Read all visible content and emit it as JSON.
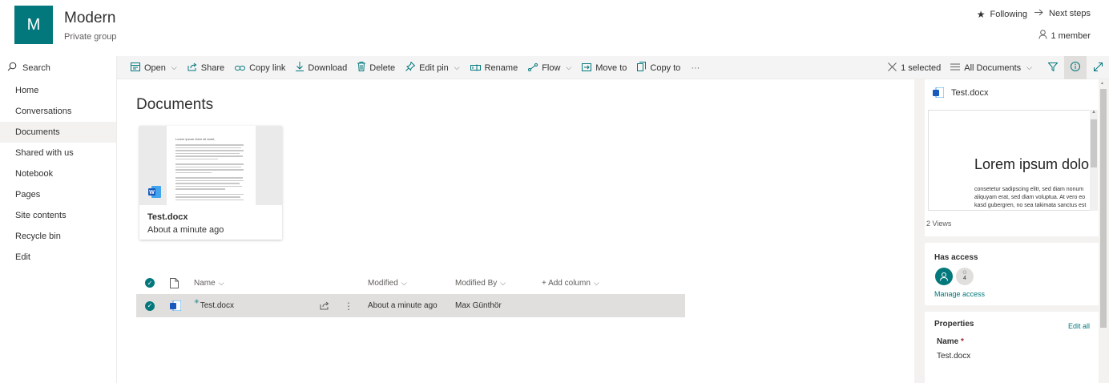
{
  "colors": {
    "accent": "#03787c",
    "nav_selected": "#f3f2f1",
    "row_selected": "#e1dfdd",
    "panel_bg": "#f3f2f1"
  },
  "site": {
    "logo_letter": "M",
    "title": "Modern",
    "subtitle": "Private group"
  },
  "header_actions": {
    "following": "Following",
    "next_steps": "Next steps",
    "members": "1 member"
  },
  "search": {
    "label": "Search"
  },
  "commands": [
    {
      "label": "Open",
      "icon": "open-icon",
      "chevron": true
    },
    {
      "label": "Share",
      "icon": "share-icon",
      "chevron": false
    },
    {
      "label": "Copy link",
      "icon": "link-icon",
      "chevron": false
    },
    {
      "label": "Download",
      "icon": "download-icon",
      "chevron": false
    },
    {
      "label": "Delete",
      "icon": "delete-icon",
      "chevron": false
    },
    {
      "label": "Edit pin",
      "icon": "pin-icon",
      "chevron": true
    },
    {
      "label": "Rename",
      "icon": "rename-icon",
      "chevron": false
    },
    {
      "label": "Flow",
      "icon": "flow-icon",
      "chevron": true
    },
    {
      "label": "Move to",
      "icon": "move-icon",
      "chevron": false
    },
    {
      "label": "Copy to",
      "icon": "copy-icon",
      "chevron": false
    }
  ],
  "more_label": "···",
  "right_commands": {
    "selected": "1 selected",
    "view": "All Documents"
  },
  "nav": {
    "items": [
      "Home",
      "Conversations",
      "Documents",
      "Shared with us",
      "Notebook",
      "Pages",
      "Site contents",
      "Recycle bin",
      "Edit"
    ],
    "selected_index": 2
  },
  "main": {
    "title": "Documents",
    "tile": {
      "name": "Test.docx",
      "meta": "About a minute ago",
      "preview_heading": "Lorem ipsum dolor sit amet,",
      "file_badge": "W"
    },
    "columns": {
      "name": "Name",
      "modified": "Modified",
      "modified_by": "Modified By",
      "add_column": "+ Add column"
    },
    "rows": [
      {
        "name": "Test.docx",
        "modified": "About a minute ago",
        "modified_by": "Max Günthör"
      }
    ]
  },
  "details": {
    "file_name": "Test.docx",
    "preview": {
      "heading": "Lorem ipsum dolor",
      "lines": [
        "consetetur sadipscing elitr, sed diam nonum",
        "aliquyam erat, sed diam voluptua. At vero eo",
        "kasd gubergren, no sea takimata sanctus est"
      ]
    },
    "views": "2 Views",
    "access": {
      "title": "Has access",
      "group_count": "4",
      "manage": "Manage access"
    },
    "properties": {
      "title": "Properties",
      "edit_all": "Edit all",
      "name_label": "Name",
      "required_mark": "*",
      "name_value": "Test.docx"
    }
  }
}
